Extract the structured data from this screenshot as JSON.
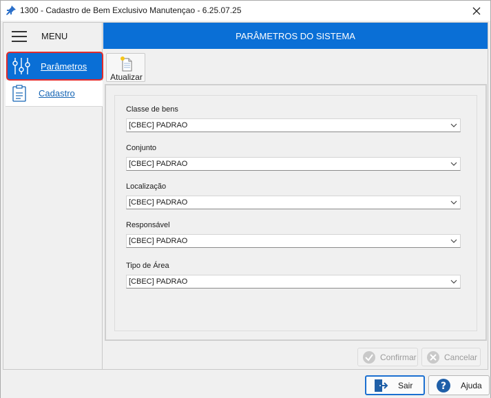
{
  "window": {
    "title": "1300 - Cadastro de Bem Exclusivo Manutençao - 6.25.07.25",
    "close_icon": "close-icon",
    "pin_icon": "pin-icon"
  },
  "sidebar": {
    "menu_label": "MENU",
    "items": [
      {
        "label": "Parâmetros",
        "icon": "sliders-icon",
        "active": true
      },
      {
        "label": "Cadastro",
        "icon": "clipboard-icon",
        "active": false
      }
    ]
  },
  "header": {
    "title": "PARÂMETROS DO SISTEMA"
  },
  "toolbar": {
    "refresh_label": "Atualizar",
    "refresh_icon": "document-new-icon"
  },
  "form": {
    "fields": [
      {
        "label": "Classe de bens",
        "value": "[CBEC] PADRAO"
      },
      {
        "label": "Conjunto",
        "value": "[CBEC] PADRAO"
      },
      {
        "label": "Localização",
        "value": "[CBEC] PADRAO"
      },
      {
        "label": "Responsável",
        "value": "[CBEC] PADRAO"
      },
      {
        "label": "Tipo de Área",
        "value": "[CBEC] PADRAO"
      }
    ]
  },
  "actions": {
    "confirm_label": "Confirmar",
    "cancel_label": "Cancelar"
  },
  "footer": {
    "exit_label": "Sair",
    "help_label": "Ajuda"
  },
  "colors": {
    "accent": "#0a6fd6",
    "active_border": "#e22b2b"
  }
}
